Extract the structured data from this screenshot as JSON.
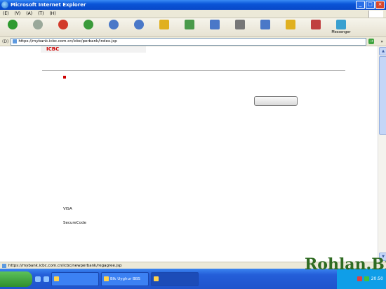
{
  "window": {
    "title": "Microsoft Internet Explorer"
  },
  "menu": [
    "(E)",
    "(V)",
    "(A)",
    "(T)",
    "(H)"
  ],
  "toolbar": {
    "items": [
      {
        "label": "",
        "icon": "back-icon",
        "color": "#2f9a2f"
      },
      {
        "label": "",
        "icon": "forward-icon",
        "color": "#9aa89a"
      },
      {
        "label": "",
        "icon": "stop-icon",
        "color": "#d23a2a"
      },
      {
        "label": "",
        "icon": "refresh-icon",
        "color": "#3a9a3a"
      },
      {
        "label": "",
        "icon": "home-icon",
        "color": "#4a78c8"
      },
      {
        "label": "",
        "icon": "search-icon",
        "color": "#4a78c8"
      },
      {
        "label": "",
        "icon": "favorites-icon",
        "color": "#e0b020"
      },
      {
        "label": "",
        "icon": "history-icon",
        "color": "#4a9a4a"
      },
      {
        "label": "",
        "icon": "mail-icon",
        "color": "#4a78c8"
      },
      {
        "label": "",
        "icon": "print-icon",
        "color": "#777777"
      },
      {
        "label": "",
        "icon": "edit-icon",
        "color": "#4a78c8"
      },
      {
        "label": "",
        "icon": "discuss-icon",
        "color": "#e0b020"
      },
      {
        "label": "",
        "icon": "research-icon",
        "color": "#c04040"
      },
      {
        "label": "Messenger",
        "icon": "messenger-icon",
        "color": "#3aa0d0"
      }
    ]
  },
  "address": {
    "label": "(D)",
    "url": "https://mybank.icbc.com.cn/icbc/perbank/index.jsp",
    "links": "»"
  },
  "page": {
    "logo_text": "ICBC",
    "logo_sub": "",
    "nav_left": "",
    "nav_right": "",
    "title": "",
    "section_title": "",
    "intro_line1": "",
    "intro_line2": "",
    "register_button": "",
    "intro_line3": "",
    "tips_title": "",
    "tip1_line1": "",
    "tip1_line2": "",
    "tip2_line1": "",
    "tip2_line2": "",
    "tip2_line3": "",
    "tip3": "VISA",
    "tip4": "SecureCode",
    "tip5_line1": "",
    "tip5_line2": "",
    "tip_sub": ""
  },
  "status": {
    "text": "https://mybank.icbc.com.cn/icbc/newperbank/regagree.jsp"
  },
  "taskbar": {
    "start_label": "",
    "tasks": [
      {
        "label": "",
        "active": false
      },
      {
        "label": "Blk Uyghur BBS",
        "active": false
      },
      {
        "label": "",
        "active": true
      }
    ],
    "clock": "20:50"
  },
  "watermark": {
    "arabic": "",
    "latin": "Rohlan.Biz"
  }
}
